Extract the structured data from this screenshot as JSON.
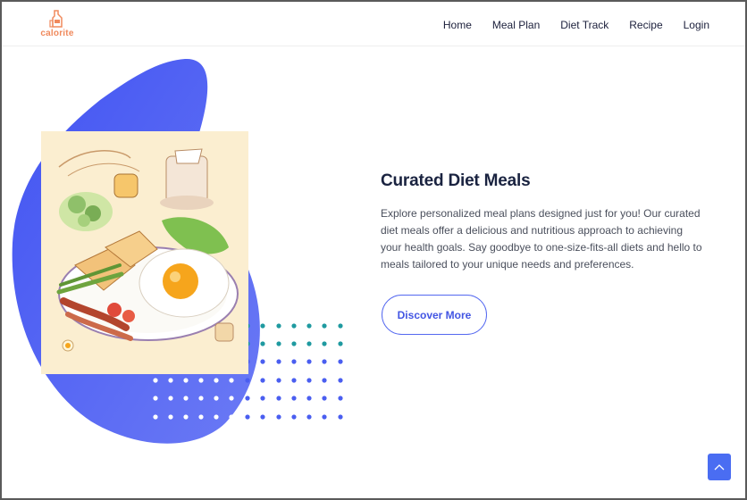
{
  "brand": {
    "name": "calorite",
    "icon": "bottle-icon",
    "color": "#f08a5d"
  },
  "nav": {
    "items": [
      {
        "label": "Home"
      },
      {
        "label": "Meal Plan"
      },
      {
        "label": "Diet Track"
      },
      {
        "label": "Recipe"
      },
      {
        "label": "Login"
      }
    ]
  },
  "hero": {
    "heading": "Curated Diet Meals",
    "description": "Explore personalized meal plans designed just for you! Our curated diet meals offer a delicious and nutritious approach to achieving your health goals. Say goodbye to one-size-fits-all diets and hello to meals tailored to your unique needs and preferences.",
    "cta_label": "Discover More",
    "image_icon": "breakfast-plate-illustration"
  },
  "colors": {
    "accent": "#4a6df2",
    "heading": "#1a2340",
    "dots_teal": "#1f9aa0"
  },
  "scroll_top": {
    "icon": "chevron-up-icon"
  }
}
